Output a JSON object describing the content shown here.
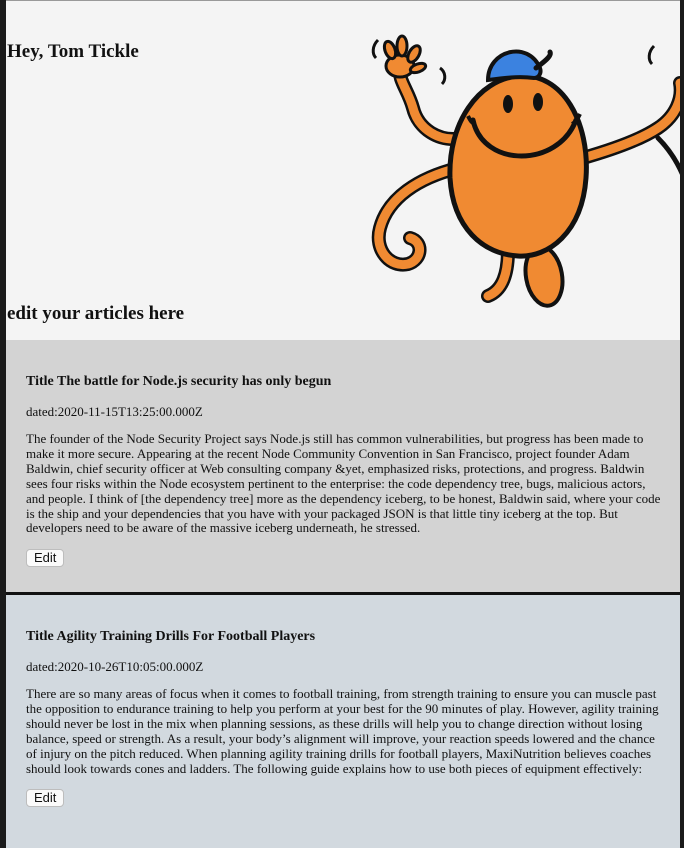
{
  "header": {
    "greeting": "Hey, Tom Tickle",
    "mascot_icon": "orange-cartoon-character-with-blue-cap"
  },
  "section": {
    "heading": "edit your articles here"
  },
  "articles": [
    {
      "title_prefix": "Title",
      "title": "The battle for Node.js security has only begun",
      "date_prefix": "dated:",
      "date": "2020-11-15T13:25:00.000Z",
      "body": "The founder of the Node Security Project says Node.js still has common vulnerabilities, but progress has been made to make it more secure. Appearing at the recent Node Community Convention in San Francisco, project founder Adam Baldwin, chief security officer at Web consulting company &yet, emphasized risks, protections, and progress. Baldwin sees four risks within the Node ecosystem pertinent to the enterprise: the code dependency tree, bugs, malicious actors, and people. I think of [the dependency tree] more as the dependency iceberg, to be honest, Baldwin said, where your code is the ship and your dependencies that you have with your packaged JSON is that little tiny iceberg at the top. But developers need to be aware of the massive iceberg underneath, he stressed.",
      "edit_label": "Edit",
      "background": "#d3d3d3"
    },
    {
      "title_prefix": "Title",
      "title": "Agility Training Drills For Football Players",
      "date_prefix": "dated:",
      "date": "2020-10-26T10:05:00.000Z",
      "body": "There are so many areas of focus when it comes to football training, from strength training to ensure you can muscle past the opposition to endurance training to help you perform at your best for the 90 minutes of play. However, agility training should never be lost in the mix when planning sessions, as these drills will help you to change direction without losing balance, speed or strength. As a result, your body’s alignment will improve, your reaction speeds lowered and the chance of injury on the pitch reduced. When planning agility training drills for football players, MaxiNutrition believes coaches should look towards cones and ladders. The following guide explains how to use both pieces of equipment effectively:",
      "edit_label": "Edit",
      "background": "#d2d9df"
    }
  ]
}
